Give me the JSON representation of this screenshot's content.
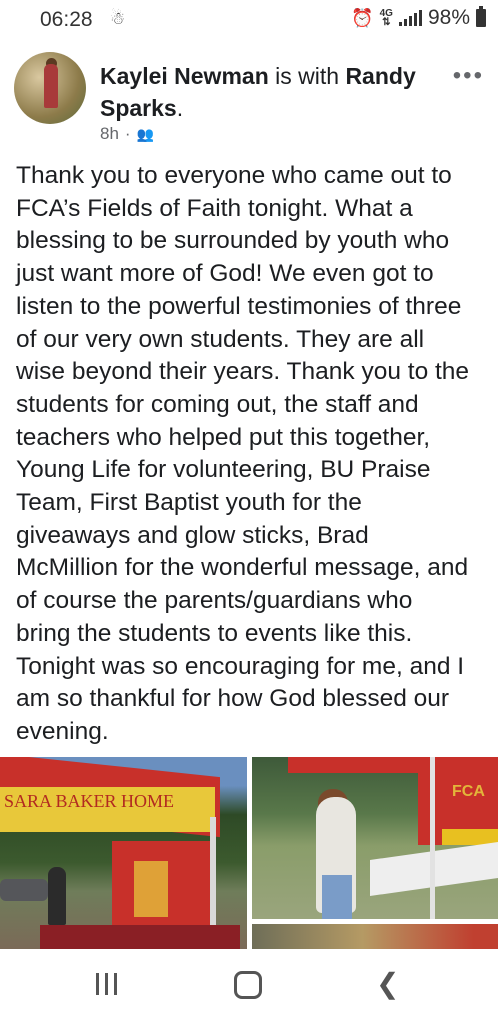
{
  "status_bar": {
    "time": "06:28",
    "battery": "98%"
  },
  "post": {
    "author": "Kaylei Newman",
    "connector": " is with ",
    "tagged": "Randy Sparks",
    "tagged_suffix": ".",
    "time_ago": "8h",
    "separator": "·",
    "audience_icon": "friends-icon",
    "body": "Thank you to everyone who came out to\nFCA’s Fields of Faith tonight. What a\nblessing to be surrounded by youth who\njust want more of God! We even got to\nlisten to the powerful testimonies of three\nof our very own students. They are all\nwise beyond their years. Thank you to the\nstudents for coming out, the staff and\nteachers who helped put this together,\nYoung Life for volunteering, BU Praise\nTeam, First Baptist youth for the\ngiveaways and glow sticks, Brad\nMcMillion for the wonderful message, and\nof course the parents/guardians who\nbring the students to events like this.\nTonight was so encouraging for me, and I\nam so thankful for how God blessed our\nevening.",
    "photo_1_sign": "SARA BAKER HOME",
    "photo_2_sign": "FCA"
  },
  "icons": {
    "more": "more-options-icon",
    "recents": "recents-icon",
    "home": "home-icon",
    "back": "back-icon"
  },
  "colors": {
    "text": "#1c1e21",
    "meta": "#65676b",
    "tent_red": "#c8302a",
    "tent_yellow": "#e8c83a"
  }
}
